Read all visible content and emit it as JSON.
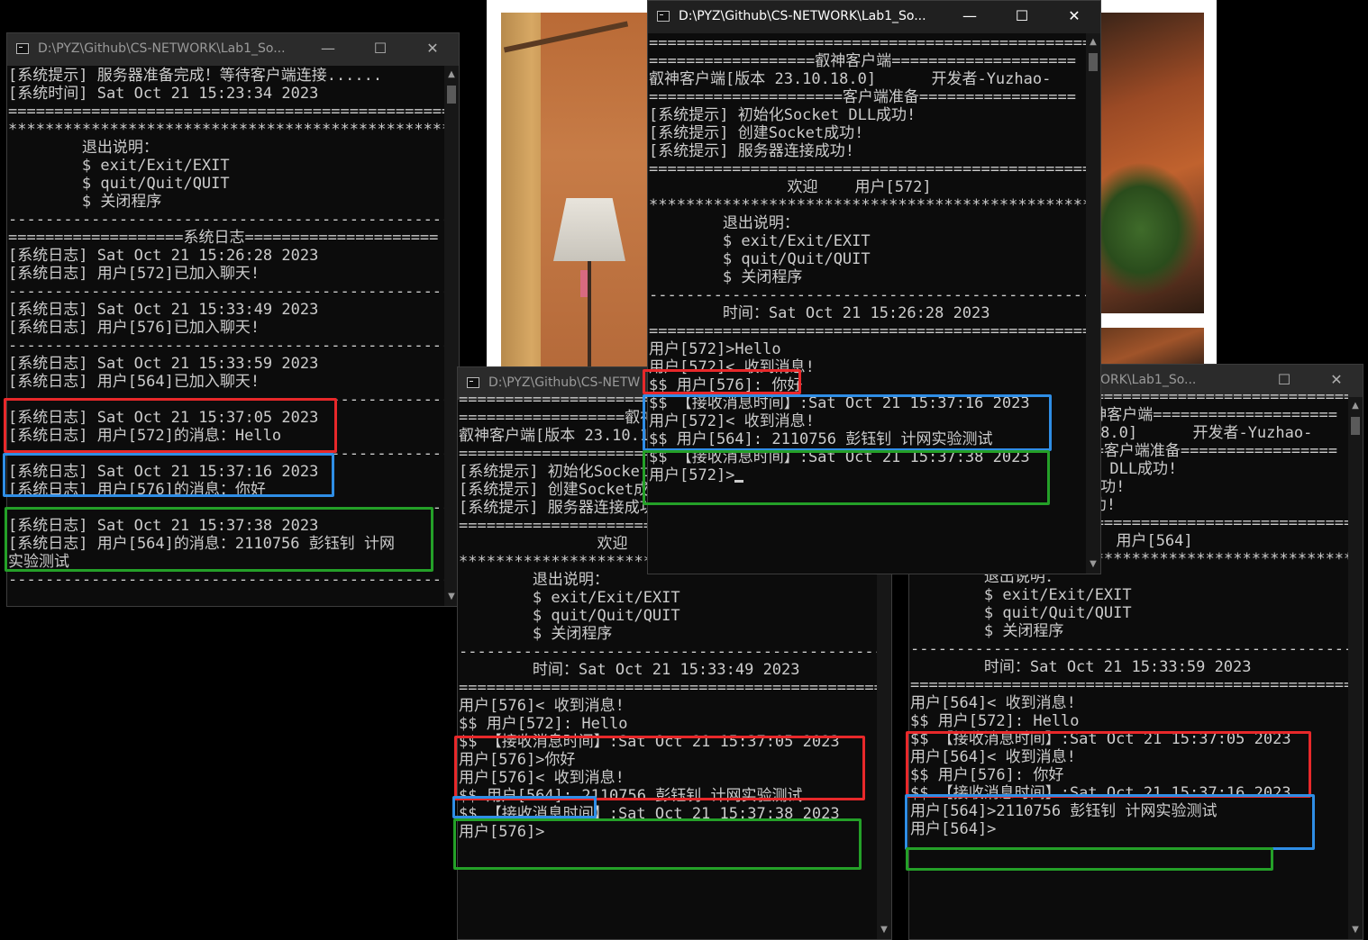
{
  "server_window": {
    "title": "D:\\PYZ\\Github\\CS-NETWORK\\Lab1_So...",
    "lines": [
      "[系统提示] 服务器准备完成！等待客户端连接......",
      "[系统时间] Sat Oct 21 15:23:34 2023",
      "================================================",
      "************************************************",
      "        退出说明：",
      "        $ exit/Exit/EXIT",
      "        $ quit/Quit/QUIT",
      "        $ 关闭程序",
      "------------------------------------------------",
      "===================系统日志=====================",
      "[系统日志] Sat Oct 21 15:26:28 2023",
      "[系统日志] 用户[572]已加入聊天!",
      "------------------------------------------------",
      "[系统日志] Sat Oct 21 15:33:49 2023",
      "[系统日志] 用户[576]已加入聊天!",
      "------------------------------------------------",
      "[系统日志] Sat Oct 21 15:33:59 2023",
      "[系统日志] 用户[564]已加入聊天!",
      "------------------------------------------------",
      "[系统日志] Sat Oct 21 15:37:05 2023",
      "[系统日志] 用户[572]的消息：Hello",
      "------------------------------------------------",
      "[系统日志] Sat Oct 21 15:37:16 2023",
      "[系统日志] 用户[576]的消息：你好",
      "------------------------------------------------",
      "[系统日志] Sat Oct 21 15:37:38 2023",
      "[系统日志] 用户[564]的消息：2110756 彭钰钊 计网",
      "实验测试",
      "------------------------------------------------"
    ]
  },
  "client_572": {
    "title": "D:\\PYZ\\Github\\CS-NETWORK\\Lab1_So...",
    "lines": [
      "================================================",
      "==================叡神客户端====================",
      "叡神客户端[版本 23.10.18.0]      开发者-Yuzhao-",
      "=====================客户端准备=================",
      "[系统提示] 初始化Socket DLL成功!",
      "[系统提示] 创建Socket成功!",
      "[系统提示] 服务器连接成功!",
      "================================================",
      "               欢迎    用户[572]",
      "************************************************",
      "        退出说明：",
      "        $ exit/Exit/EXIT",
      "        $ quit/Quit/QUIT",
      "        $ 关闭程序",
      "------------------------------------------------",
      "        时间：Sat Oct 21 15:26:28 2023",
      "================================================",
      "用户[572]>Hello",
      "用户[572]< 收到消息!",
      "$$ 用户[576]: 你好",
      "$$ 【接收消息时间】:Sat Oct 21 15:37:16 2023",
      "用户[572]< 收到消息!",
      "$$ 用户[564]: 2110756 彭钰钊 计网实验测试",
      "$$ 【接收消息时间】:Sat Oct 21 15:37:38 2023",
      "用户[572]>"
    ]
  },
  "client_576": {
    "title": "D:\\PYZ\\Github\\CS-NETW",
    "lines": [
      "================================================",
      "==================叡神客户端====================",
      "叡神客户端[版本 23.10.18.0]      开发者-Yuzhao-",
      "=====================客户端准备=================",
      "[系统提示] 初始化Socket DLL成功!",
      "[系统提示] 创建Socket成功!",
      "[系统提示] 服务器连接成功!",
      "================================================",
      "               欢迎    用户[576]",
      "************************************************",
      "        退出说明：",
      "        $ exit/Exit/EXIT",
      "        $ quit/Quit/QUIT",
      "        $ 关闭程序",
      "------------------------------------------------",
      "        时间：Sat Oct 21 15:33:49 2023",
      "================================================",
      "用户[576]< 收到消息!",
      "$$ 用户[572]: Hello",
      "$$ 【接收消息时间】:Sat Oct 21 15:37:05 2023",
      "用户[576]>你好",
      "用户[576]< 收到消息!",
      "$$ 用户[564]: 2110756 彭钰钊 计网实验测试",
      "$$ 【接收消息时间】:Sat Oct 21 15:37:38 2023",
      "用户[576]>"
    ]
  },
  "client_564": {
    "title": "ORK\\Lab1_So...",
    "lines": [
      "================================================",
      "==================叡神客户端====================",
      "叡神客户端[版本 23.10.18.0]      开发者-Yuzhao-",
      "=====================客户端准备=================",
      "[系统提示] 初始化Socket DLL成功!",
      "[系统提示] 创建Socket成功!",
      "[系统提示] 服务器连接成功!",
      "================================================",
      "               欢迎    用户[564]",
      "************************************************",
      "        退出说明：",
      "        $ exit/Exit/EXIT",
      "        $ quit/Quit/QUIT",
      "        $ 关闭程序",
      "------------------------------------------------",
      "        时间：Sat Oct 21 15:33:59 2023",
      "================================================",
      "用户[564]< 收到消息!",
      "$$ 用户[572]: Hello",
      "$$ 【接收消息时间】:Sat Oct 21 15:37:05 2023",
      "用户[564]< 收到消息!",
      "$$ 用户[576]: 你好",
      "$$ 【接收消息时间】:Sat Oct 21 15:37:16 2023",
      "用户[564]>2110756 彭钰钊 计网实验测试",
      "用户[564]>"
    ]
  },
  "window_controls": {
    "minimize": "—",
    "maximize": "☐",
    "close": "✕"
  },
  "colors": {
    "highlight_red": "#e8282a",
    "highlight_blue": "#2f8ee6",
    "highlight_green": "#24a028",
    "console_bg": "#0c0c0c",
    "console_text": "#cccccc"
  }
}
